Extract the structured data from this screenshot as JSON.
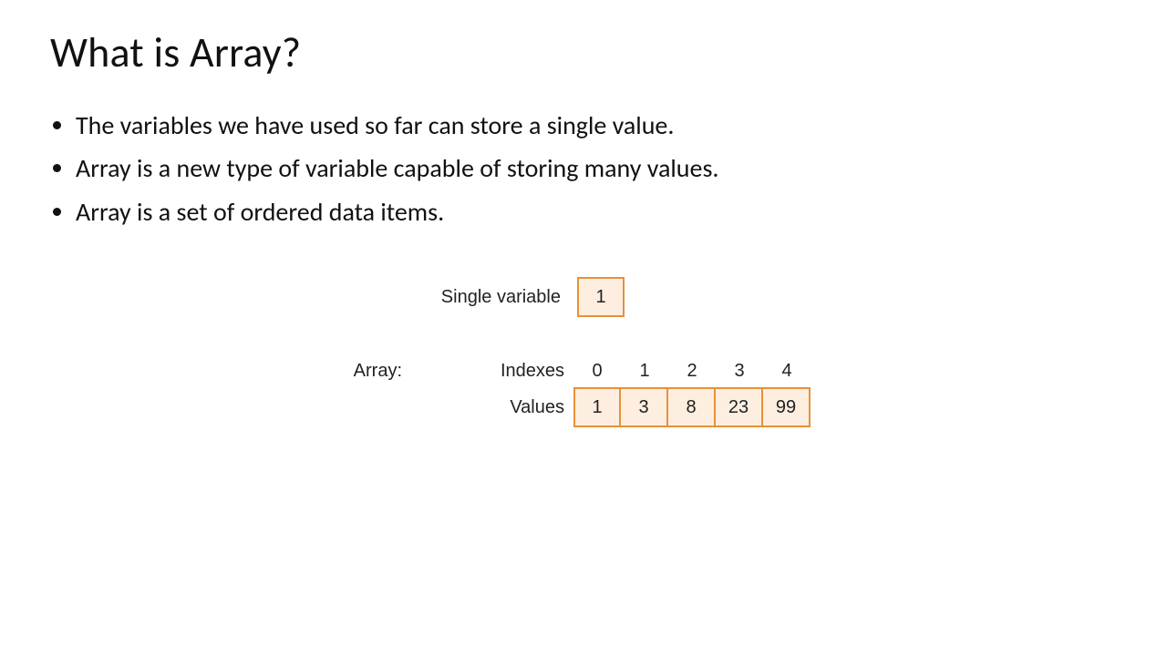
{
  "title": "What is Array?",
  "bullets": [
    "The variables we have used so far can store a single value.",
    "Array is a new type of variable capable of storing many values.",
    "Array is a set of ordered data items."
  ],
  "diagram": {
    "single_label": "Single variable",
    "single_value": "1",
    "array_label": "Array:",
    "indexes_label": "Indexes",
    "values_label": "Values",
    "indexes": [
      "0",
      "1",
      "2",
      "3",
      "4"
    ],
    "values": [
      "1",
      "3",
      "8",
      "23",
      "99"
    ]
  }
}
